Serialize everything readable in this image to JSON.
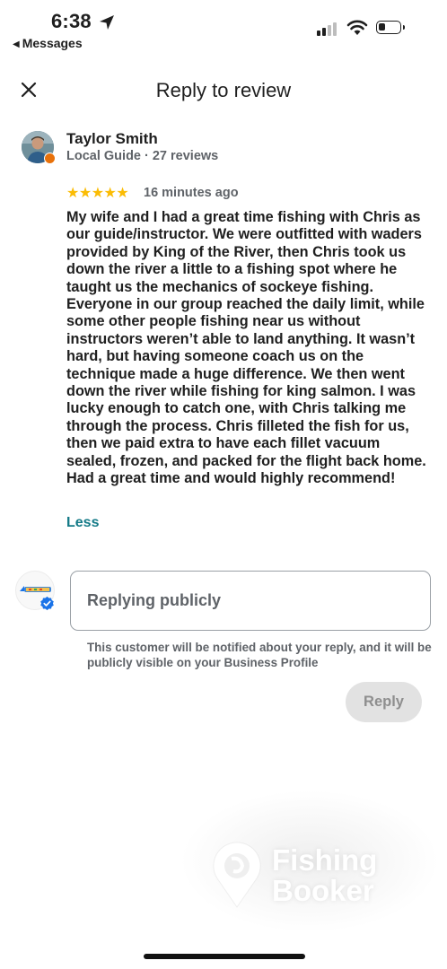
{
  "status_bar": {
    "time": "6:38",
    "back_label": "Messages"
  },
  "header": {
    "title": "Reply to review"
  },
  "review": {
    "reviewer_name": "Taylor Smith",
    "reviewer_meta": "Local Guide · 27 reviews",
    "rating": 5,
    "stars_text": "★★★★★",
    "time_ago": "16 minutes ago",
    "text": "My wife and I had a great time fishing with Chris as our guide/instructor. We were outfitted with waders provided by King of the River, then Chris took us down the river a little to a fishing spot where he taught us the mechanics of sockeye fishing. Everyone in our group reached the daily limit, while some other people fishing near us without instructors weren’t able to land anything. It wasn’t hard, but having someone coach us on the technique made a huge difference. We then went down the river while fishing for king salmon. I was lucky enough to catch one, with Chris talking me through the process. Chris filleted the fish for us, then we paid extra to have each fillet vacuum sealed, frozen, and packed for the flight back home. Had a great time and would highly recommend!",
    "less_label": "Less"
  },
  "reply": {
    "placeholder": "Replying publicly",
    "value": "",
    "notice": "This customer will be notified about your reply, and it will be publicly visible on your Business Profile",
    "button_label": "Reply"
  },
  "watermark": {
    "line1": "Fishing",
    "line2": "Booker"
  },
  "colors": {
    "star": "#fbbc04",
    "link": "#137a87",
    "muted": "#5f6368",
    "button_bg": "#e2e2e2"
  }
}
